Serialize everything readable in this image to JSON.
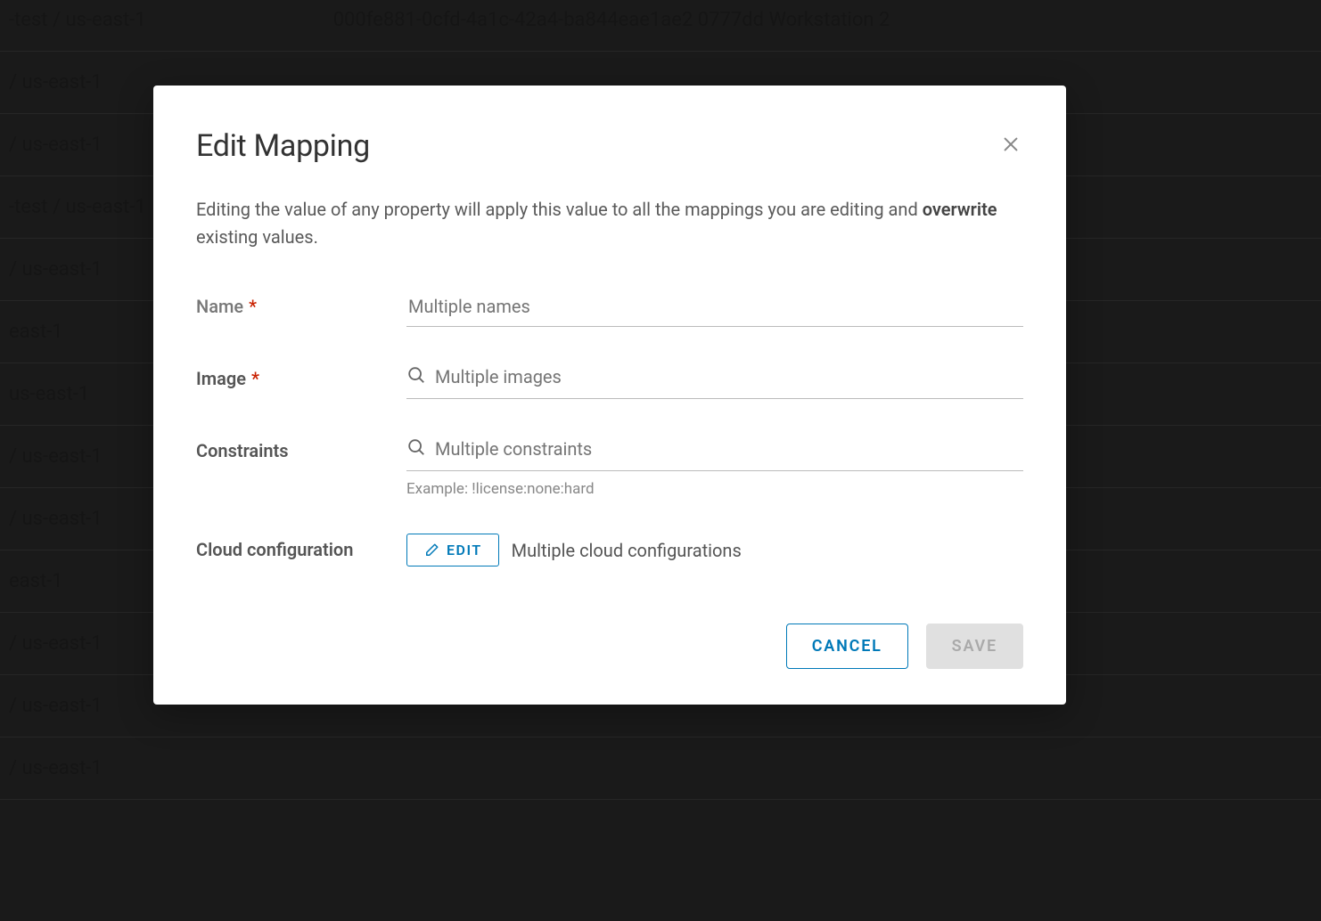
{
  "background": {
    "header_left": "-test / us-east-1",
    "header_right": "000fe881-0cfd-4a1c-42a4-ba844eae1ae2 0777dd Workstation 2",
    "rows": [
      "/ us-east-1",
      "/ us-east-1",
      "-test / us-east-1",
      "/ us-east-1",
      "east-1",
      "us-east-1",
      "/ us-east-1",
      "/ us-east-1",
      "east-1",
      "/ us-east-1",
      "/ us-east-1",
      "/ us-east-1"
    ]
  },
  "modal": {
    "title": "Edit Mapping",
    "description_prefix": "Editing the value of any property will apply this value to all the mappings you are editing and ",
    "description_bold": "overwrite",
    "description_suffix": " existing values.",
    "fields": {
      "name": {
        "label": "Name",
        "placeholder": "Multiple names"
      },
      "image": {
        "label": "Image",
        "placeholder": "Multiple images"
      },
      "constraints": {
        "label": "Constraints",
        "placeholder": "Multiple constraints",
        "helper": "Example: !license:none:hard"
      },
      "cloud_config": {
        "label": "Cloud configuration",
        "edit_button": "EDIT",
        "value": "Multiple cloud configurations"
      }
    },
    "buttons": {
      "cancel": "CANCEL",
      "save": "SAVE"
    }
  }
}
